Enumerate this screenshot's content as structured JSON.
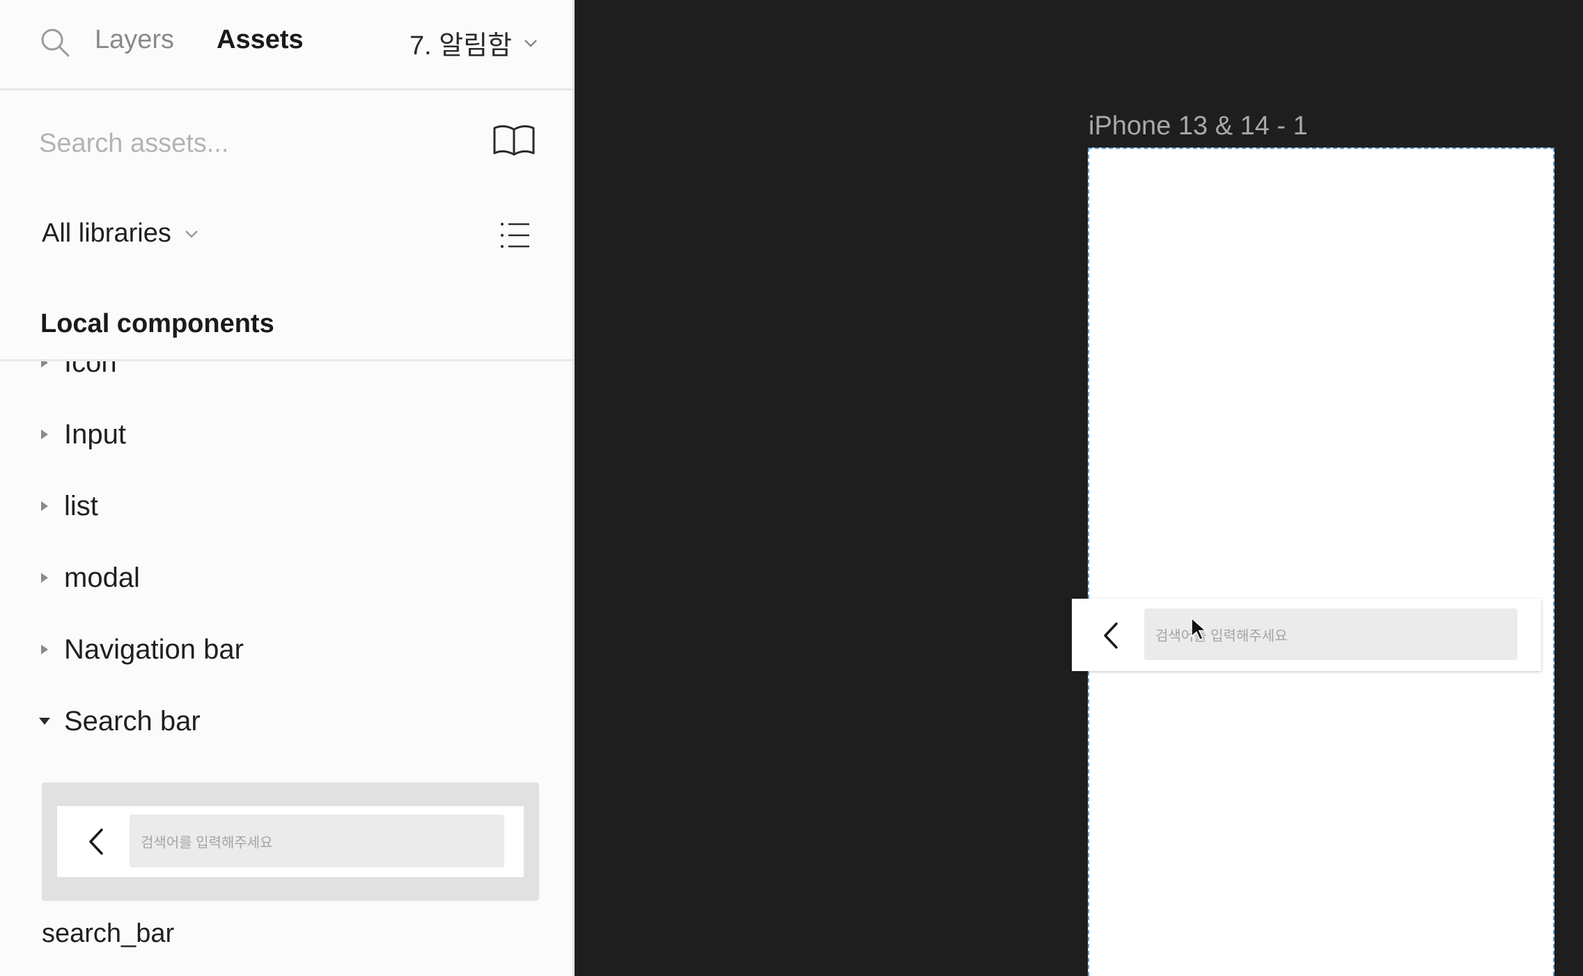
{
  "panel": {
    "tabs": {
      "layers": "Layers",
      "assets": "Assets"
    },
    "page_selector": "7. 알림함",
    "search": {
      "placeholder": "Search assets..."
    },
    "libraries": "All libraries",
    "section_title": "Local components",
    "tree": [
      {
        "label": "Icon",
        "expanded": false
      },
      {
        "label": "Input",
        "expanded": false
      },
      {
        "label": "list",
        "expanded": false
      },
      {
        "label": "modal",
        "expanded": false
      },
      {
        "label": "Navigation bar",
        "expanded": false
      },
      {
        "label": "Search bar",
        "expanded": true
      }
    ],
    "component": {
      "name": "search_bar",
      "placeholder": "검색어를 입력해주세요"
    }
  },
  "canvas": {
    "frame_label": "iPhone 13 & 14 - 1",
    "placed_component": {
      "placeholder": "검색어를 입력해주세요"
    }
  },
  "icons": {
    "search": "search-icon",
    "library": "book-icon",
    "list_view": "list-icon",
    "dropdown": "chevron-down-icon",
    "collapsed": "caret-right-icon",
    "expanded": "caret-down-icon",
    "back": "chevron-left-icon",
    "cursor": "cursor-icon"
  },
  "colors": {
    "panel_bg": "#fbfbfc",
    "canvas_bg": "#1e1e1e",
    "frame_selection": "#5b9bd5"
  }
}
